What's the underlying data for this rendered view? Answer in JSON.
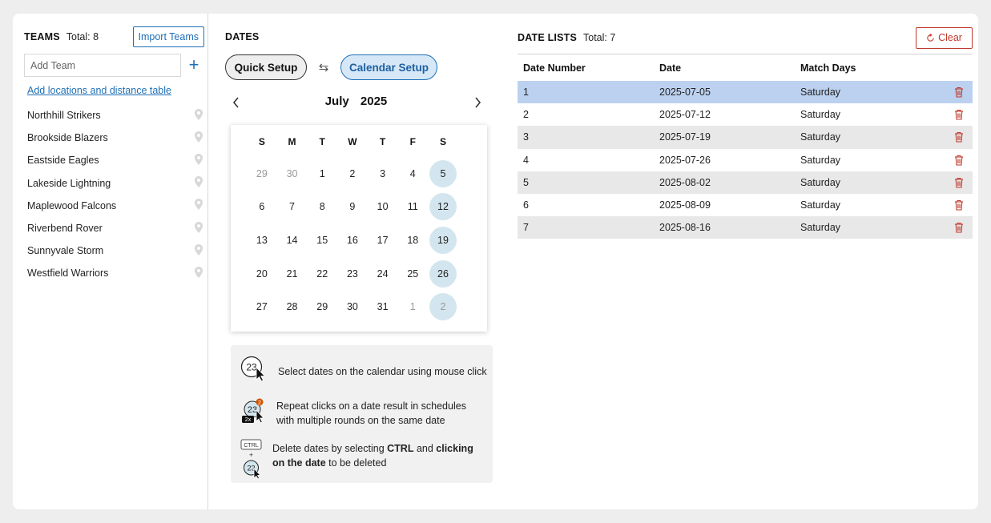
{
  "teams": {
    "title": "TEAMS",
    "total": "Total: 8",
    "import_label": "Import Teams",
    "add_placeholder": "Add Team",
    "locations_link": "Add locations and distance table ",
    "items": [
      "Northhill Strikers",
      "Brookside Blazers",
      "Eastside Eagles",
      "Lakeside Lightning",
      "Maplewood Falcons",
      "Riverbend Rover",
      "Sunnyvale Storm",
      "Westfield Warriors"
    ]
  },
  "dates": {
    "title": "DATES",
    "quick_setup": "Quick Setup",
    "calendar_setup": "Calendar Setup",
    "month": "July",
    "year": "2025",
    "weekdays": [
      "S",
      "M",
      "T",
      "W",
      "T",
      "F",
      "S"
    ],
    "days": [
      {
        "d": "29",
        "muted": true,
        "sel": false
      },
      {
        "d": "30",
        "muted": true,
        "sel": false
      },
      {
        "d": "1",
        "muted": false,
        "sel": false
      },
      {
        "d": "2",
        "muted": false,
        "sel": false
      },
      {
        "d": "3",
        "muted": false,
        "sel": false
      },
      {
        "d": "4",
        "muted": false,
        "sel": false
      },
      {
        "d": "5",
        "muted": false,
        "sel": true
      },
      {
        "d": "6",
        "muted": false,
        "sel": false
      },
      {
        "d": "7",
        "muted": false,
        "sel": false
      },
      {
        "d": "8",
        "muted": false,
        "sel": false
      },
      {
        "d": "9",
        "muted": false,
        "sel": false
      },
      {
        "d": "10",
        "muted": false,
        "sel": false
      },
      {
        "d": "11",
        "muted": false,
        "sel": false
      },
      {
        "d": "12",
        "muted": false,
        "sel": true
      },
      {
        "d": "13",
        "muted": false,
        "sel": false
      },
      {
        "d": "14",
        "muted": false,
        "sel": false
      },
      {
        "d": "15",
        "muted": false,
        "sel": false
      },
      {
        "d": "16",
        "muted": false,
        "sel": false
      },
      {
        "d": "17",
        "muted": false,
        "sel": false
      },
      {
        "d": "18",
        "muted": false,
        "sel": false
      },
      {
        "d": "19",
        "muted": false,
        "sel": true
      },
      {
        "d": "20",
        "muted": false,
        "sel": false
      },
      {
        "d": "21",
        "muted": false,
        "sel": false
      },
      {
        "d": "22",
        "muted": false,
        "sel": false
      },
      {
        "d": "23",
        "muted": false,
        "sel": false
      },
      {
        "d": "24",
        "muted": false,
        "sel": false
      },
      {
        "d": "25",
        "muted": false,
        "sel": false
      },
      {
        "d": "26",
        "muted": false,
        "sel": true
      },
      {
        "d": "27",
        "muted": false,
        "sel": false
      },
      {
        "d": "28",
        "muted": false,
        "sel": false
      },
      {
        "d": "29",
        "muted": false,
        "sel": false
      },
      {
        "d": "30",
        "muted": false,
        "sel": false
      },
      {
        "d": "31",
        "muted": false,
        "sel": false
      },
      {
        "d": "1",
        "muted": true,
        "sel": false
      },
      {
        "d": "2",
        "muted": true,
        "sel": true
      }
    ],
    "help": {
      "select_text": "Select dates on the calendar using mouse click",
      "repeat_text": "Repeat clicks on a date result in schedules with multiple rounds on the same date",
      "delete_pre": "Delete dates by selecting ",
      "delete_ctrl": "CTRL",
      "delete_mid": " and ",
      "delete_bold2": "clicking on the date",
      "delete_post": " to be deleted",
      "icon_day": "23",
      "icon_badge": "2",
      "icon_multiplier": "2x",
      "icon_ctrl_key": "CTRL",
      "icon_plus": "+"
    }
  },
  "date_lists": {
    "title": "DATE LISTS",
    "total": "Total: 7",
    "clear_label": "Clear",
    "columns": [
      "Date Number",
      "Date",
      "Match Days"
    ],
    "rows": [
      {
        "num": "1",
        "date": "2025-07-05",
        "day": "Saturday"
      },
      {
        "num": "2",
        "date": "2025-07-12",
        "day": "Saturday"
      },
      {
        "num": "3",
        "date": "2025-07-19",
        "day": "Saturday"
      },
      {
        "num": "4",
        "date": "2025-07-26",
        "day": "Saturday"
      },
      {
        "num": "5",
        "date": "2025-08-02",
        "day": "Saturday"
      },
      {
        "num": "6",
        "date": "2025-08-09",
        "day": "Saturday"
      },
      {
        "num": "7",
        "date": "2025-08-16",
        "day": "Saturday"
      }
    ]
  },
  "colors": {
    "accent": "#1f6fb5",
    "danger": "#c0392b",
    "selected_day": "#d3e6ef",
    "highlight_row": "#bcd1ef"
  }
}
